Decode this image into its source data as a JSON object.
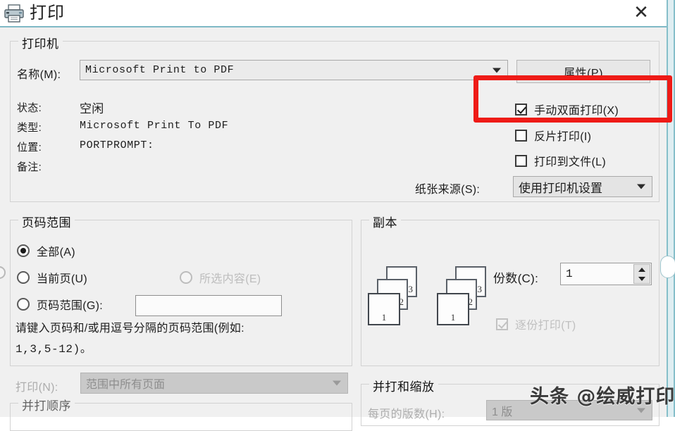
{
  "window": {
    "title": "打印",
    "icon": "printer-icon",
    "close_label": "✕"
  },
  "printer_group": {
    "legend": "打印机",
    "name_label": "名称(M):",
    "name_value": "Microsoft Print to PDF",
    "properties_button": "属性(P)",
    "status_label": "状态:",
    "status_value": "空闲",
    "type_label": "类型:",
    "type_value": "Microsoft Print To PDF",
    "location_label": "位置:",
    "location_value": "PORTPROMPT:",
    "comment_label": "备注:",
    "comment_value": "",
    "checkboxes": [
      {
        "label": "手动双面打印(X)",
        "checked": true,
        "disabled": false,
        "name": "manual-duplex"
      },
      {
        "label": "反片打印(I)",
        "checked": false,
        "disabled": false,
        "name": "reverse-print"
      },
      {
        "label": "打印到文件(L)",
        "checked": false,
        "disabled": false,
        "name": "print-to-file"
      }
    ],
    "paper_source_label": "纸张来源(S):",
    "paper_source_value": "使用打印机设置"
  },
  "page_range_group": {
    "legend": "页码范围",
    "options": [
      {
        "label": "全部(A)",
        "selected": true,
        "disabled": false,
        "name": "all-pages"
      },
      {
        "label": "当前页(U)",
        "selected": false,
        "disabled": false,
        "name": "current-page"
      },
      {
        "label": "所选内容(E)",
        "selected": false,
        "disabled": true,
        "name": "selection"
      },
      {
        "label": "页码范围(G):",
        "selected": false,
        "disabled": false,
        "name": "page-range"
      }
    ],
    "range_input_value": "",
    "hint_line1": "请键入页码和/或用逗号分隔的页码范围(例如:",
    "hint_line2": "1,3,5-12)。"
  },
  "copies_group": {
    "legend": "副本",
    "preview_page_numbers": [
      "3",
      "2",
      "1"
    ],
    "count_label": "份数(C):",
    "count_value": "1",
    "collate_label": "逐份打印(T)",
    "collate_checked": true,
    "collate_disabled": true
  },
  "bottom": {
    "print_label": "打印(N):",
    "print_value": "范围中所有页面",
    "order_legend": "并打顺序",
    "zoom_legend": "并打和缩放",
    "pages_per_sheet_label": "每页的版数(H):",
    "pages_per_sheet_value": "1 版"
  },
  "annotation": {
    "highlight_color": "#ee1b17",
    "target": "手动双面打印(X)"
  },
  "watermark": {
    "text": "头条 @绘威打印"
  }
}
